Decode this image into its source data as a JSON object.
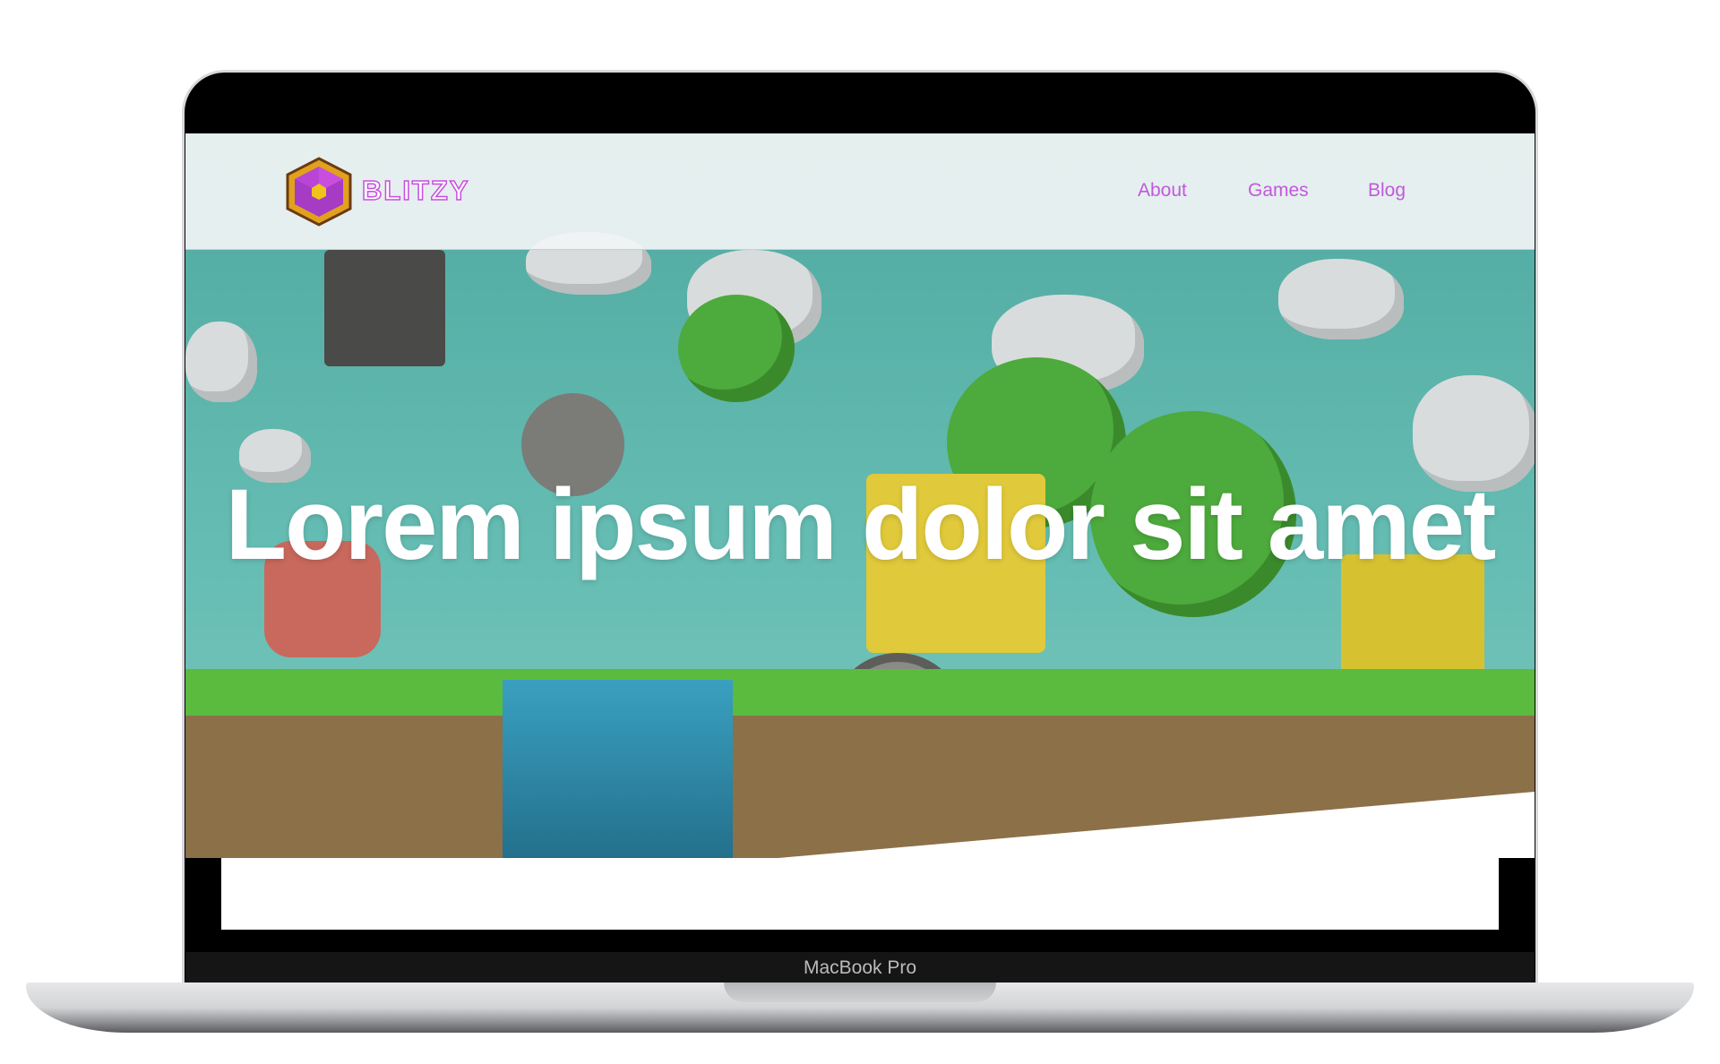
{
  "device": {
    "label": "MacBook Pro"
  },
  "header": {
    "brand": "BLITZY",
    "nav": [
      {
        "label": "About"
      },
      {
        "label": "Games"
      },
      {
        "label": "Blog"
      }
    ]
  },
  "hero": {
    "headline": "Lorem ipsum dolor sit amet"
  },
  "colors": {
    "accent": "#c258dd",
    "sky": "#5cb3a9",
    "grass": "#5bbb3e",
    "dirt": "#8c7048"
  }
}
